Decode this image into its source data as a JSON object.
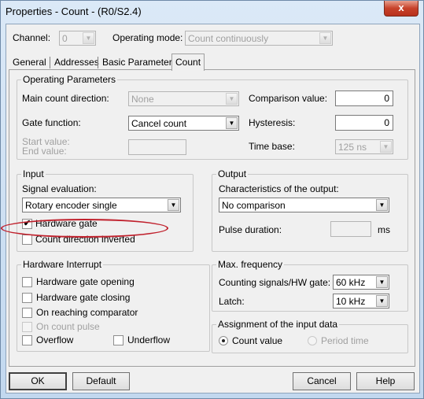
{
  "window": {
    "title": "Properties - Count - (R0/S2.4)",
    "close_label": "x"
  },
  "header": {
    "channel_label": "Channel:",
    "channel_value": "0",
    "operating_mode_label": "Operating mode:",
    "operating_mode_value": "Count continuously"
  },
  "tabs": [
    {
      "label": "General",
      "active": false
    },
    {
      "label": "Addresses",
      "active": false
    },
    {
      "label": "Basic Parameters",
      "active": false
    },
    {
      "label": "Count",
      "active": true
    }
  ],
  "operating_parameters": {
    "title": "Operating Parameters",
    "main_count_direction_label": "Main count direction:",
    "main_count_direction_value": "None",
    "gate_function_label": "Gate function:",
    "gate_function_value": "Cancel count",
    "start_value_label": "Start value:",
    "end_value_label": "End value:",
    "start_end_value": "",
    "comparison_value_label": "Comparison value:",
    "comparison_value": "0",
    "hysteresis_label": "Hysteresis:",
    "hysteresis_value": "0",
    "time_base_label": "Time base:",
    "time_base_value": "125 ns"
  },
  "input": {
    "title": "Input",
    "signal_evaluation_label": "Signal evaluation:",
    "signal_evaluation_value": "Rotary encoder single",
    "hardware_gate_label": "Hardware gate",
    "hardware_gate_checked": true,
    "count_direction_inverted_label": "Count direction inverted",
    "count_direction_inverted_checked": false
  },
  "output": {
    "title": "Output",
    "characteristics_label": "Characteristics of the output:",
    "characteristics_value": "No comparison",
    "pulse_duration_label": "Pulse duration:",
    "pulse_duration_value": "",
    "pulse_duration_unit": "ms"
  },
  "hardware_interrupt": {
    "title": "Hardware Interrupt",
    "gate_opening_label": "Hardware gate opening",
    "gate_closing_label": "Hardware gate closing",
    "reaching_comparator_label": "On reaching comparator",
    "count_pulse_label": "On count pulse",
    "overflow_label": "Overflow",
    "underflow_label": "Underflow"
  },
  "max_frequency": {
    "title": "Max. frequency",
    "counting_signals_label": "Counting signals/HW gate:",
    "counting_signals_value": "60 kHz",
    "latch_label": "Latch:",
    "latch_value": "10 kHz"
  },
  "assignment": {
    "title": "Assignment of the input data",
    "count_value_label": "Count value",
    "count_value_selected": true,
    "period_time_label": "Period time",
    "period_time_selected": false
  },
  "buttons": {
    "ok": "OK",
    "default": "Default",
    "cancel": "Cancel",
    "help": "Help"
  },
  "colors": {
    "annotation": "#c0202c"
  }
}
